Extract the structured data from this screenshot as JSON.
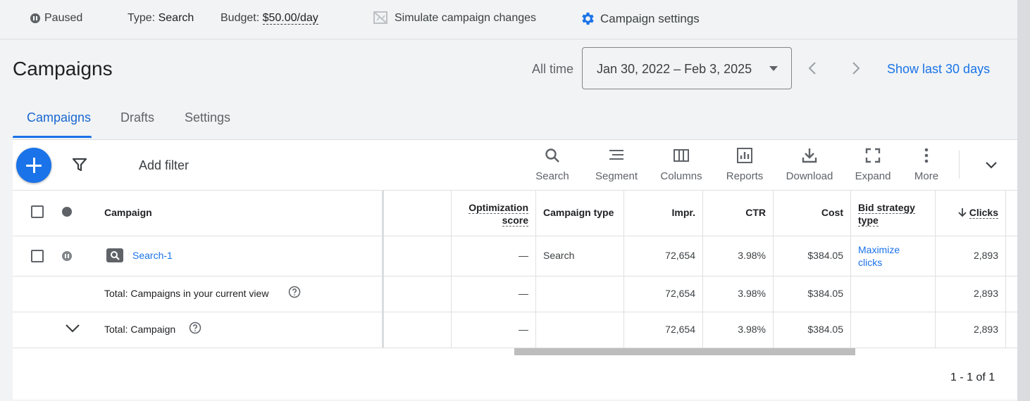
{
  "status": {
    "state": "Paused",
    "type_label": "Type:",
    "type_value": "Search",
    "budget_label": "Budget:",
    "budget_value": "$50.00/day",
    "simulate": "Simulate campaign changes",
    "settings": "Campaign settings"
  },
  "header": {
    "title": "Campaigns",
    "range_label": "All time",
    "date_range": "Jan 30, 2022 – Feb 3, 2025",
    "show_last": "Show last 30 days"
  },
  "tabs": [
    {
      "label": "Campaigns",
      "active": true
    },
    {
      "label": "Drafts",
      "active": false
    },
    {
      "label": "Settings",
      "active": false
    }
  ],
  "toolbar": {
    "add_filter": "Add filter",
    "tools": [
      {
        "label": "Search",
        "icon": "search-icon"
      },
      {
        "label": "Segment",
        "icon": "segment-icon"
      },
      {
        "label": "Columns",
        "icon": "columns-icon"
      },
      {
        "label": "Reports",
        "icon": "reports-icon"
      },
      {
        "label": "Download",
        "icon": "download-icon"
      },
      {
        "label": "Expand",
        "icon": "expand-icon"
      },
      {
        "label": "More",
        "icon": "more-vert-icon"
      }
    ]
  },
  "table": {
    "columns": {
      "campaign": "Campaign",
      "opt_score_1": "Optimization",
      "opt_score_2": "score",
      "campaign_type": "Campaign type",
      "impr": "Impr.",
      "ctr": "CTR",
      "cost": "Cost",
      "bid_1": "Bid strategy",
      "bid_2": "type",
      "clicks": "Clicks"
    },
    "rows": [
      {
        "campaign": "Search-1",
        "opt_score": "—",
        "campaign_type": "Search",
        "impr": "72,654",
        "ctr": "3.98%",
        "cost": "$384.05",
        "bid_1": "Maximize",
        "bid_2": "clicks",
        "clicks": "2,893"
      }
    ],
    "totals": [
      {
        "label": "Total: Campaigns in your current view",
        "opt_score": "—",
        "impr": "72,654",
        "ctr": "3.98%",
        "cost": "$384.05",
        "clicks": "2,893"
      },
      {
        "label": "Total: Campaign",
        "opt_score": "—",
        "impr": "72,654",
        "ctr": "3.98%",
        "cost": "$384.05",
        "clicks": "2,893"
      }
    ],
    "pagination": "1 - 1 of 1"
  },
  "colors": {
    "accent": "#1a73e8",
    "background": "#f1f3f4",
    "text": "#202124"
  }
}
